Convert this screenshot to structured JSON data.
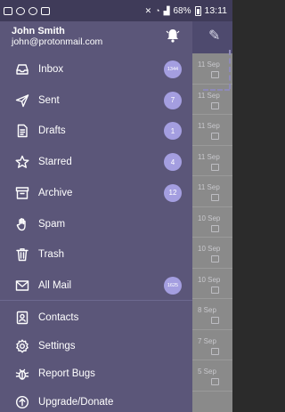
{
  "status_bar": {
    "battery": "68%",
    "time": "13:11"
  },
  "account": {
    "name": "John Smith",
    "email": "john@protonmail.com"
  },
  "menu": [
    {
      "id": "inbox",
      "label": "Inbox",
      "icon": "inbox-icon",
      "badge": "1344"
    },
    {
      "id": "sent",
      "label": "Sent",
      "icon": "sent-icon",
      "badge": "7"
    },
    {
      "id": "drafts",
      "label": "Drafts",
      "icon": "drafts-icon",
      "badge": "1"
    },
    {
      "id": "starred",
      "label": "Starred",
      "icon": "star-icon",
      "badge": "4"
    },
    {
      "id": "archive",
      "label": "Archive",
      "icon": "archive-icon",
      "badge": "12"
    },
    {
      "id": "spam",
      "label": "Spam",
      "icon": "spam-icon",
      "badge": ""
    },
    {
      "id": "trash",
      "label": "Trash",
      "icon": "trash-icon",
      "badge": ""
    },
    {
      "id": "allmail",
      "label": "All Mail",
      "icon": "mail-icon",
      "badge": "1625"
    }
  ],
  "secondary_menu": [
    {
      "id": "contacts",
      "label": "Contacts",
      "icon": "contacts-icon"
    },
    {
      "id": "settings",
      "label": "Settings",
      "icon": "gear-icon"
    },
    {
      "id": "report",
      "label": "Report Bugs",
      "icon": "bug-icon"
    },
    {
      "id": "upgrade",
      "label": "Upgrade/Donate",
      "icon": "upgrade-icon"
    }
  ],
  "background_list_dates": [
    "11 Sep",
    "11 Sep",
    "11 Sep",
    "11 Sep",
    "11 Sep",
    "10 Sep",
    "10 Sep",
    "10 Sep",
    "8 Sep",
    "7 Sep",
    "5 Sep"
  ],
  "colors": {
    "drawer": "#5b5679",
    "badge": "#a49ee0",
    "statusbar": "#3f3b59"
  }
}
